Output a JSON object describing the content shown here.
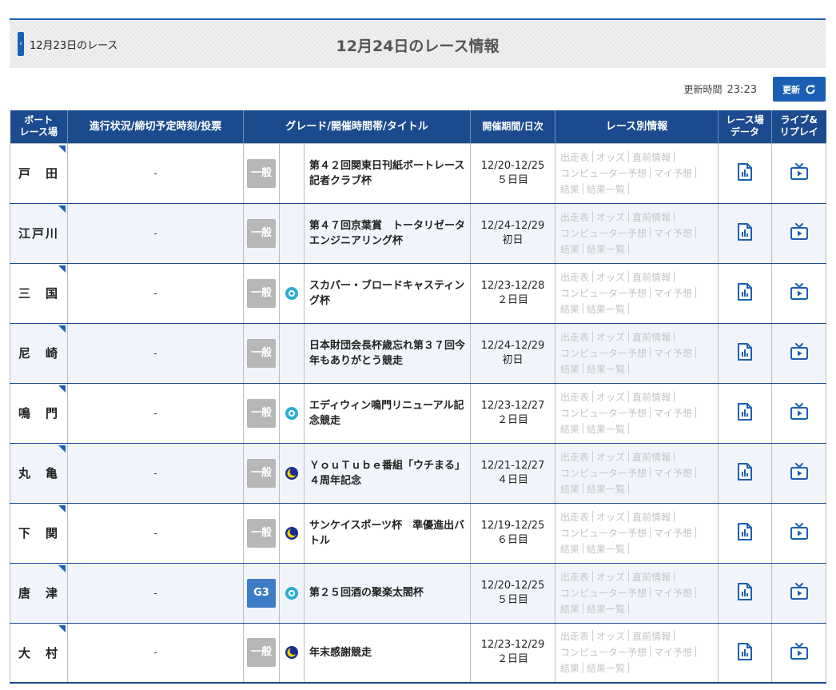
{
  "header": {
    "prev_label": "12月23日のレース",
    "title": "12月24日のレース情報"
  },
  "update": {
    "label": "更新時間",
    "time": "23:23",
    "button_label": "更新"
  },
  "columns": {
    "venue": [
      "ボート",
      "レース場"
    ],
    "status": "進行状況/締切予定時刻/投票",
    "grade_title": "グレード/開催時間帯/タイトル",
    "period": "開催期間/日次",
    "links": "レース別情報",
    "venue_data": [
      "レース場",
      "データ"
    ],
    "live_replay": [
      "ライブ&",
      "リプレイ"
    ]
  },
  "link_labels": {
    "entry": "出走表",
    "odds": "オッズ",
    "before": "直前情報",
    "computer": "コンピューター予想",
    "my_prediction": "マイ予想",
    "result": "結果",
    "result_list": "結果一覧"
  },
  "colors": {
    "header_blue": "#1c4a8f",
    "accent_blue": "#1b5fb4",
    "grade_gray": "#b7b7b7",
    "grade_g3": "#3f7cc8",
    "morning_teal": "#2aaed3",
    "night_yellow": "#f3d400",
    "night_navy": "#1c2f8f"
  },
  "races": [
    {
      "venue": "戸　田",
      "status": "-",
      "grade": "一般",
      "time_icon": "none",
      "title": "第４２回関東日刊紙ボートレース記者クラブ杯",
      "period": "12/20-12/25",
      "day": "５日目"
    },
    {
      "venue": "江戸川",
      "status": "-",
      "grade": "一般",
      "time_icon": "none",
      "title": "第４７回京葉賞　トータリゼータエンジニアリング杯",
      "period": "12/24-12/29",
      "day": "初日"
    },
    {
      "venue": "三　国",
      "status": "-",
      "grade": "一般",
      "time_icon": "morning-icon",
      "title": "スカパー・ブロードキャスティング杯",
      "period": "12/23-12/28",
      "day": "２日目"
    },
    {
      "venue": "尼　崎",
      "status": "-",
      "grade": "一般",
      "time_icon": "none",
      "title": "日本財団会長杯歳忘れ第３７回今年もありがとう競走",
      "period": "12/24-12/29",
      "day": "初日"
    },
    {
      "venue": "鳴　門",
      "status": "-",
      "grade": "一般",
      "time_icon": "morning-icon",
      "title": "エディウィン鳴門リニューアル記念競走",
      "period": "12/23-12/27",
      "day": "２日目"
    },
    {
      "venue": "丸　亀",
      "status": "-",
      "grade": "一般",
      "time_icon": "night-icon",
      "title": "ＹｏｕＴｕｂｅ番組「ウチまる」４周年記念",
      "period": "12/21-12/27",
      "day": "４日目"
    },
    {
      "venue": "下　関",
      "status": "-",
      "grade": "一般",
      "time_icon": "night-icon",
      "title": "サンケイスポーツ杯　準優進出バトル",
      "period": "12/19-12/25",
      "day": "６日目"
    },
    {
      "venue": "唐　津",
      "status": "-",
      "grade": "G3",
      "time_icon": "morning-icon",
      "title": "第２５回酒の聚楽太閤杯",
      "period": "12/20-12/25",
      "day": "５日目"
    },
    {
      "venue": "大　村",
      "status": "-",
      "grade": "一般",
      "time_icon": "night-icon",
      "title": "年末感謝競走",
      "period": "12/23-12/29",
      "day": "２日目"
    }
  ]
}
